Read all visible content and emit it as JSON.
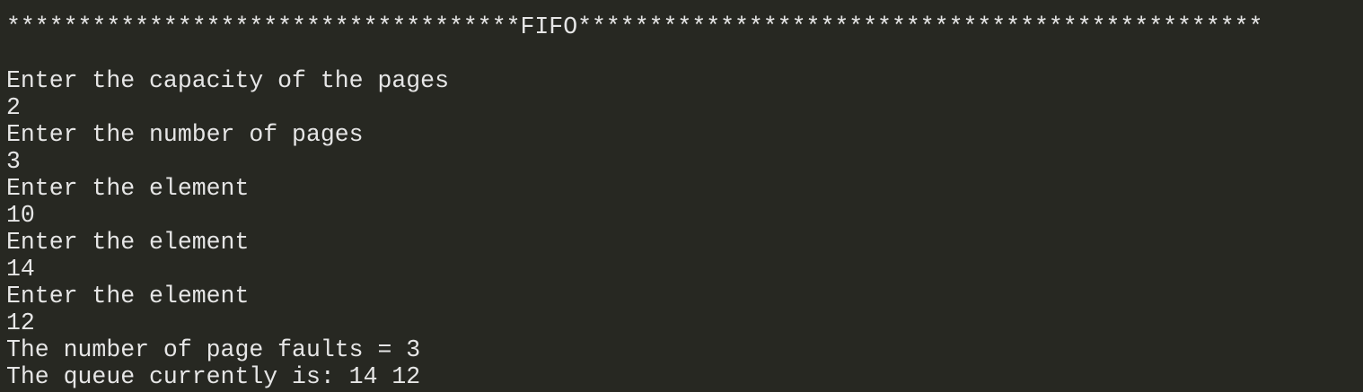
{
  "terminal": {
    "lines": [
      "************************************FIFO************************************************",
      "",
      "Enter the capacity of the pages",
      "2",
      "Enter the number of pages",
      "3",
      "Enter the element",
      "10",
      "Enter the element",
      "14",
      "Enter the element",
      "12",
      "The number of page faults = 3",
      "The queue currently is: 14 12"
    ]
  },
  "colors": {
    "background": "#272822",
    "text": "#e6e6e6"
  }
}
